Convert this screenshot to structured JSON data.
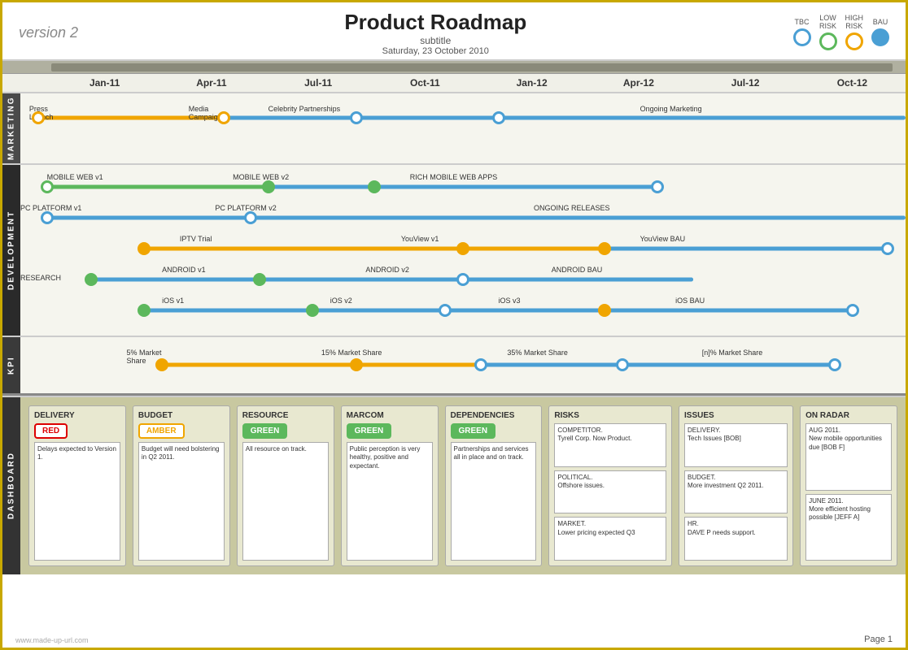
{
  "header": {
    "version": "version 2",
    "title": "Product Roadmap",
    "subtitle": "subtitle",
    "date": "Saturday, 23 October 2010"
  },
  "legend": [
    {
      "id": "tbc",
      "label": "TBC",
      "style": "tbc"
    },
    {
      "id": "low-risk",
      "label": "LOW\nRISK",
      "style": "low"
    },
    {
      "id": "high-risk",
      "label": "HIGH\nRISK",
      "style": "high"
    },
    {
      "id": "bau",
      "label": "BAU",
      "style": "bau"
    }
  ],
  "timeLabels": [
    "Jan-11",
    "Apr-11",
    "Jul-11",
    "Oct-11",
    "Jan-12",
    "Apr-12",
    "Jul-12",
    "Oct-12"
  ],
  "sections": {
    "marketing": "MARKETING",
    "development": "DEVELOPMENT",
    "kpi": "KPI",
    "dashboard": "DASHBOARD"
  },
  "dashboard": {
    "delivery": {
      "title": "DELIVERY",
      "badge": "RED",
      "badgeType": "red",
      "text": "Delays expected to Version 1."
    },
    "budget": {
      "title": "BUDGET",
      "badge": "AMBER",
      "badgeType": "amber",
      "text": "Budget will need bolstering in Q2 2011."
    },
    "resource": {
      "title": "RESOURCE",
      "badge": "GREEN",
      "badgeType": "green",
      "text": "All resource on track."
    },
    "marcom": {
      "title": "MARCOM",
      "badge": "GREEN",
      "badgeType": "green",
      "text": "Public perception is very healthy, positive and expectant."
    },
    "dependencies": {
      "title": "DEPENDENCIES",
      "badge": "GREEN",
      "badgeType": "green",
      "text": "Partnerships and services all in place and on track."
    },
    "risks": {
      "title": "RISKS",
      "items": [
        "COMPETITOR.\nTyrell Corp. Now Product.",
        "POLITICAL.\nOffshore issues.",
        "MARKET.\nLower pricing expected Q3"
      ]
    },
    "issues": {
      "title": "ISSUES",
      "items": [
        "DELIVERY.\nTech Issues [BOB]",
        "BUDGET.\nMore investment Q2 2011.",
        "HR.\nDAVE P needs support."
      ]
    },
    "onRadar": {
      "title": "ON RADAR",
      "items": [
        "AUG 2011.\nNew mobile opportunities due [BOB F]",
        "JUNE 2011.\nMore efficient hosting possible [JEFF A]"
      ]
    }
  },
  "footer": {
    "pageLabel": "Page 1",
    "watermark": "www.made-up-url.com"
  }
}
